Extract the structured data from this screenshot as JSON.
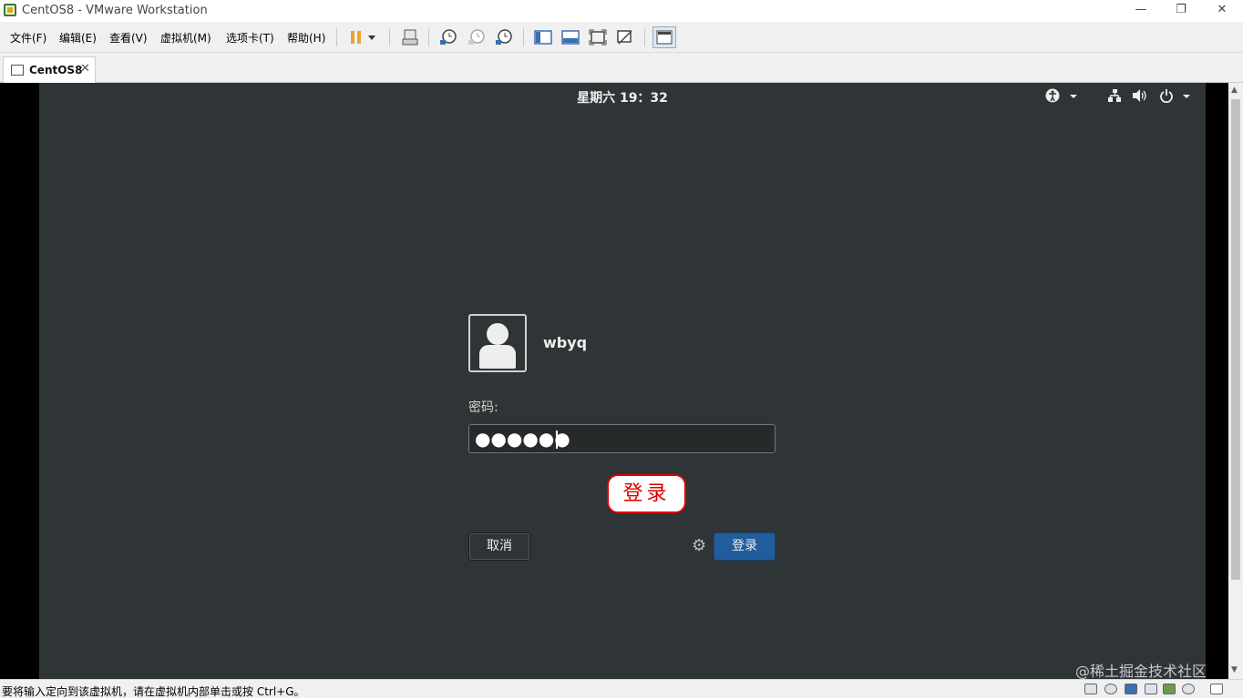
{
  "window": {
    "title": "CentOS8 - VMware Workstation",
    "controls": {
      "minimize": "—",
      "restore": "❐",
      "close": "✕"
    }
  },
  "menu": {
    "items": [
      "文件(F)",
      "编辑(E)",
      "查看(V)",
      "虚拟机(M)",
      "选项卡(T)",
      "帮助(H)"
    ]
  },
  "toolbar": {
    "icons": [
      "pause-icon",
      "dropdown-icon",
      "send-ctrl-alt-del-icon",
      "snapshot-take-icon",
      "snapshot-revert-icon",
      "snapshot-manager-icon",
      "sidebar-toggle-icon",
      "thumbnail-bar-icon",
      "fullscreen-icon",
      "unity-icon",
      "console-view-icon"
    ],
    "colors": {
      "pause": "#f0a030",
      "accent": "#3a6fb0"
    }
  },
  "tab": {
    "label": "CentOS8",
    "close": "✕"
  },
  "gdm": {
    "clock": "星期六 19：32",
    "username": "wbyq",
    "password_label": "密码:",
    "password_dots": "●●●●●●",
    "annotation": "登录",
    "cancel_button": "取消",
    "login_button": "登录",
    "topbar_icons": [
      "accessibility-icon",
      "network-icon",
      "volume-icon",
      "power-icon"
    ],
    "colors": {
      "background": "#2f3436",
      "login_button": "#215d9c",
      "annotation_border": "#dd0000"
    }
  },
  "statusbar": {
    "text": "要将输入定向到该虚拟机，请在虚拟机内部单击或按 Ctrl+G。",
    "watermark": "@稀土掘金技术社区",
    "icons": [
      "hdd-icon",
      "cd-icon",
      "network-adapter-icon",
      "printer-icon",
      "usb-icon",
      "sound-icon",
      "message-icon"
    ]
  }
}
